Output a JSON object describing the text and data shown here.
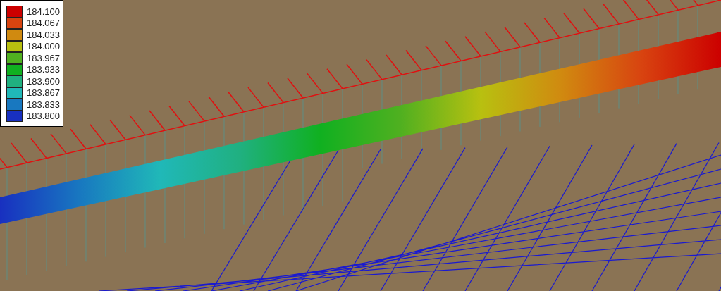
{
  "legend": {
    "entries": [
      {
        "label": "184.100",
        "color": "#cc0000"
      },
      {
        "label": "184.067",
        "color": "#d84410"
      },
      {
        "label": "184.033",
        "color": "#d08a10"
      },
      {
        "label": "184.000",
        "color": "#b8c010"
      },
      {
        "label": "183.967",
        "color": "#50b020"
      },
      {
        "label": "183.933",
        "color": "#10b020"
      },
      {
        "label": "183.900",
        "color": "#20b080"
      },
      {
        "label": "183.867",
        "color": "#20b8b8"
      },
      {
        "label": "183.833",
        "color": "#1878c0"
      },
      {
        "label": "183.800",
        "color": "#1830c0"
      }
    ]
  }
}
